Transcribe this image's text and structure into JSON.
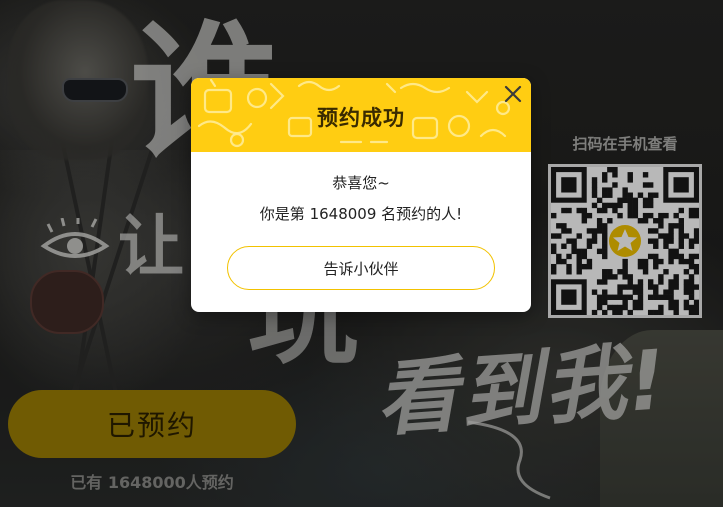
{
  "background": {
    "headline_chars": "谁",
    "line2_chars": "让",
    "line3_chars": "玩",
    "tagline": "看到我!"
  },
  "qr": {
    "caption": "扫码在手机查看"
  },
  "reserve": {
    "button_label": "已预约",
    "count_prefix": "已有 ",
    "count_value": "1648000",
    "count_suffix": "人预约"
  },
  "modal": {
    "title": "预约成功",
    "congrats": "恭喜您~",
    "rank_prefix": "你是第 ",
    "rank_value": "1648009",
    "rank_suffix": " 名预约的人!",
    "share_button": "告诉小伙伴",
    "close_icon": "close-icon"
  },
  "colors": {
    "accent": "#ffcd12",
    "accent_border": "#f2c200",
    "reserved_button": "#9c7f05"
  }
}
